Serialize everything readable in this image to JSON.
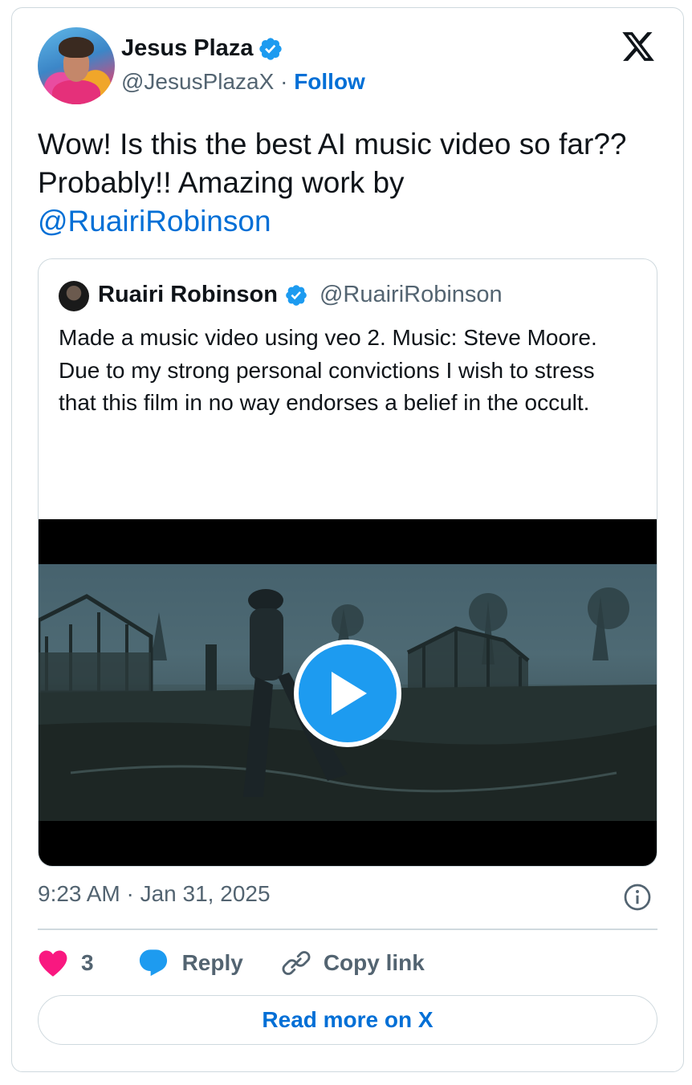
{
  "author": {
    "name": "Jesus Plaza",
    "handle": "@JesusPlazaX",
    "separator": "·",
    "follow_label": "Follow",
    "verified_icon": "verified-badge-icon"
  },
  "tweet": {
    "text": "Wow! Is this the best AI music video so far?? Probably!! Amazing work by",
    "mention": "@RuairiRobinson",
    "timestamp": "9:23 AM · Jan 31, 2025"
  },
  "quoted": {
    "name": "Ruairi Robinson",
    "handle": "@RuairiRobinson",
    "text_line1": "Made a music video using veo 2. Music: Steve Moore.",
    "text_line2": "Due to my strong personal convictions I wish to stress that this film in no way endorses a belief in the occult."
  },
  "actions": {
    "like_count": "3",
    "reply_label": "Reply",
    "copy_link_label": "Copy link"
  },
  "read_more_label": "Read more on X",
  "colors": {
    "link_blue": "#006fd6",
    "verified_blue": "#1d9bf0",
    "like_pink": "#f91880",
    "muted_text": "#536471",
    "border": "#cfd9de"
  }
}
